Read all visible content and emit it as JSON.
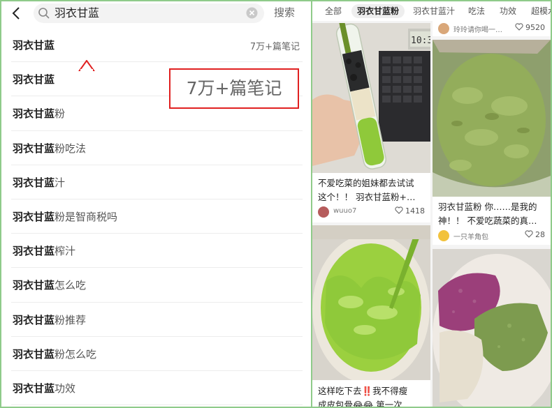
{
  "search": {
    "query": "羽衣甘蓝",
    "button": "搜索"
  },
  "suggestions": [
    {
      "keyword": "羽衣甘蓝",
      "rest": "",
      "count": "7万+篇笔记"
    },
    {
      "keyword": "羽衣甘蓝",
      "rest": ""
    },
    {
      "keyword": "羽衣甘蓝",
      "rest": "粉"
    },
    {
      "keyword": "羽衣甘蓝",
      "rest": "粉吃法"
    },
    {
      "keyword": "羽衣甘蓝",
      "rest": "汁"
    },
    {
      "keyword": "羽衣甘蓝",
      "rest": "粉是智商税吗"
    },
    {
      "keyword": "羽衣甘蓝",
      "rest": "榨汁"
    },
    {
      "keyword": "羽衣甘蓝",
      "rest": "怎么吃"
    },
    {
      "keyword": "羽衣甘蓝",
      "rest": "粉推荐"
    },
    {
      "keyword": "羽衣甘蓝",
      "rest": "粉怎么吃"
    },
    {
      "keyword": "羽衣甘蓝",
      "rest": "功效"
    }
  ],
  "callout": {
    "text": "7万+篇笔记"
  },
  "tabs": [
    "全部",
    "羽衣甘蓝粉",
    "羽衣甘蓝汁",
    "吃法",
    "功效",
    "超模水"
  ],
  "active_tab": "羽衣甘蓝粉",
  "feed": {
    "top_right": {
      "author": "玲玲请你喝一…",
      "likes": "9520"
    },
    "card1": {
      "title_line1": "不爱吃菜的姐妹都去试试",
      "title_line2": "这个！！ 羽衣甘蓝粉+…",
      "author": "wuuo7",
      "likes": "1418"
    },
    "card2": {
      "title_line1": "羽衣甘蓝粉 你……是我的",
      "title_line2": "神！！ 不爱吃蔬菜的真…",
      "author": "一只羊角包",
      "likes": "28"
    },
    "card3": {
      "title_line1": "这样吃下去‼️我不得瘦",
      "title_line2": "成皮包骨😂😂 第一次…"
    },
    "clock_digits": "10:3"
  },
  "colors": {
    "frame": "#8fcb8a",
    "callout_border": "#e02020",
    "powder_green": "#8fae5a",
    "juice_green": "#8fc93a",
    "purple_powder": "#9b3f7a"
  }
}
